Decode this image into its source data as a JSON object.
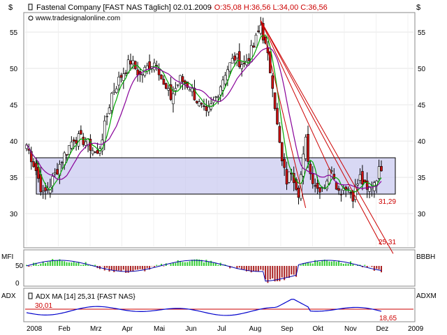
{
  "header": {
    "company": "Fastenal Company [FAST NAS  Täglich] 02.01.2009",
    "ohlc": " - O:35,08 H:36,56 L:34,00 C:36,56",
    "source": "www.tradesignalonline.com",
    "currency_left": "$",
    "currency_right": "$"
  },
  "colors": {
    "up_candle": "#ffffff",
    "down_candle": "#cc1111",
    "ma_fast": "#00aa00",
    "ma_slow": "#880099",
    "box": "#c8c8f0",
    "trend": "#cc0000",
    "mfi_pos": "#33cc33",
    "mfi_neg": "#aa2222",
    "adx": "#0000cc"
  },
  "chart_data": [
    {
      "type": "candlestick",
      "title": "Fastenal Company [FAST NAS  Täglich] 02.01.2009",
      "y_ticks": [
        "30",
        "35",
        "40",
        "45",
        "50",
        "55"
      ],
      "ylim": [
        25.5,
        57.5
      ],
      "x_ticks": [
        "2008",
        "Feb",
        "Mrz",
        "Apr",
        "Mai",
        "Jun",
        "Jul",
        "Aug",
        "Sep",
        "Okt",
        "Nov",
        "Dez",
        "2009"
      ],
      "close_path": [
        [
          0,
          39.5
        ],
        [
          8,
          36.0
        ],
        [
          14,
          32.5
        ],
        [
          20,
          34.0
        ],
        [
          30,
          37.5
        ],
        [
          40,
          40.5
        ],
        [
          50,
          40.0
        ],
        [
          60,
          38.0
        ],
        [
          66,
          42.0
        ],
        [
          72,
          46.5
        ],
        [
          80,
          49.0
        ],
        [
          88,
          51.0
        ],
        [
          96,
          49.0
        ],
        [
          104,
          50.5
        ],
        [
          110,
          51.0
        ],
        [
          116,
          47.5
        ],
        [
          122,
          46.0
        ],
        [
          130,
          48.5
        ],
        [
          138,
          47.5
        ],
        [
          146,
          45.0
        ],
        [
          152,
          43.5
        ],
        [
          160,
          46.0
        ],
        [
          168,
          49.5
        ],
        [
          176,
          51.5
        ],
        [
          184,
          50.5
        ],
        [
          192,
          53.0
        ],
        [
          198,
          56.0
        ],
        [
          204,
          51.5
        ],
        [
          208,
          48.0
        ],
        [
          212,
          42.0
        ],
        [
          216,
          37.0
        ],
        [
          220,
          34.5
        ],
        [
          224,
          36.0
        ],
        [
          230,
          33.0
        ],
        [
          236,
          40.0
        ],
        [
          240,
          35.5
        ],
        [
          246,
          33.5
        ],
        [
          252,
          34.0
        ],
        [
          258,
          36.5
        ],
        [
          264,
          33.0
        ],
        [
          270,
          34.0
        ],
        [
          276,
          32.5
        ],
        [
          282,
          35.0
        ],
        [
          288,
          33.0
        ],
        [
          294,
          34.5
        ],
        [
          300,
          36.56
        ]
      ],
      "annotations": [
        "31,29",
        "25,31"
      ],
      "support_zone": [
        32.7,
        37.7
      ]
    },
    {
      "type": "bar",
      "title": "MFI",
      "right_label": "BBBH",
      "y_ticks": [
        "50",
        "0"
      ]
    },
    {
      "type": "line",
      "title": "ADX MA [14] 25,31 {FAST NAS}",
      "legend": "ADX MA [14] 25,31 {FAST NAS}",
      "left_label": "ADX",
      "right_label": "ADXM",
      "level_left": "30,01",
      "level_right": "18,65"
    }
  ]
}
